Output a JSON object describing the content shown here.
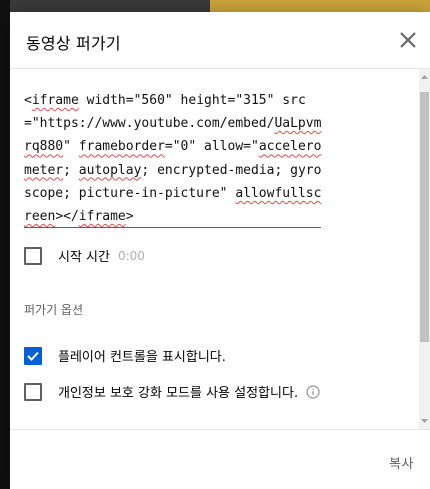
{
  "dialog": {
    "title": "동영상 퍼가기",
    "close_icon": "close-icon",
    "embed_code": {
      "segments": [
        {
          "text": "<",
          "sq": false
        },
        {
          "text": "iframe",
          "sq": true
        },
        {
          "text": " width=\"560\" height=\"315\" src=\"https://www.youtube.com/embed/",
          "sq": false
        },
        {
          "text": "UaLpvmrq880",
          "sq": true
        },
        {
          "text": "\" ",
          "sq": false
        },
        {
          "text": "frameborder",
          "sq": true
        },
        {
          "text": "=\"0\" allow=\"",
          "sq": false
        },
        {
          "text": "accelerometer",
          "sq": true
        },
        {
          "text": "; ",
          "sq": false
        },
        {
          "text": "autoplay",
          "sq": true
        },
        {
          "text": "; encrypted-media; gyroscope; picture-in-picture\" ",
          "sq": false
        },
        {
          "text": "allowfullscreen",
          "sq": true
        },
        {
          "text": "></",
          "sq": false
        },
        {
          "text": "iframe",
          "sq": true
        },
        {
          "text": ">",
          "sq": false
        }
      ]
    },
    "start_time": {
      "label": "시작 시간",
      "value": "0:00",
      "checked": false
    },
    "options_section_title": "퍼가기 옵션",
    "options": [
      {
        "label": "플레이어 컨트롤을 표시합니다.",
        "checked": true
      },
      {
        "label": "개인정보 보호 강화 모드를 사용 설정합니다.",
        "checked": false,
        "info_icon": "info-icon"
      }
    ],
    "copy_label": "복사"
  },
  "colors": {
    "accent": "#065fd4",
    "text": "#030303",
    "secondary": "#606060"
  }
}
